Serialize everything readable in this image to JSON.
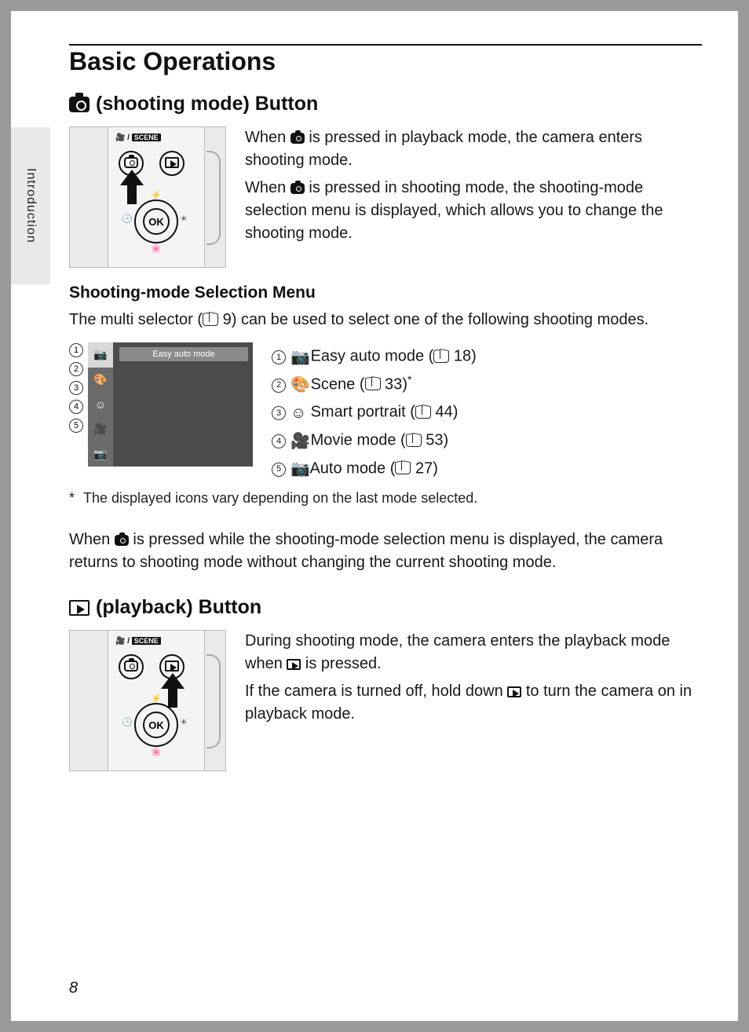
{
  "side_tab": "Introduction",
  "page_title": "Basic Operations",
  "page_number": "8",
  "section1": {
    "heading": "(shooting mode) Button",
    "para1_a": "When ",
    "para1_b": " is pressed in playback mode, the camera enters shooting mode.",
    "para2_a": "When ",
    "para2_b": " is pressed in shooting mode, the shooting-mode selection menu is displayed, which allows you to change the shooting mode."
  },
  "subsection": {
    "heading": "Shooting-mode Selection Menu",
    "intro_a": "The multi selector (",
    "intro_ref": " 9",
    "intro_b": ") can be used to select one of the following shooting modes.",
    "menu_label": "Easy auto mode",
    "modes": [
      {
        "num": "1",
        "glyph": "📷",
        "label": "Easy auto mode",
        "ref": " 18",
        "suffix": ""
      },
      {
        "num": "2",
        "glyph": "🎨",
        "label": "Scene",
        "ref": " 33",
        "suffix": "*"
      },
      {
        "num": "3",
        "glyph": "☺",
        "label": "Smart portrait",
        "ref": " 44",
        "suffix": ""
      },
      {
        "num": "4",
        "glyph": "🎥",
        "label": "Movie mode",
        "ref": " 53",
        "suffix": ""
      },
      {
        "num": "5",
        "glyph": "📷",
        "label": "Auto mode",
        "ref": " 27",
        "suffix": ""
      }
    ],
    "footnote": "The displayed icons vary depending on the last mode selected.",
    "closing_a": "When ",
    "closing_b": " is pressed while the shooting-mode selection menu is displayed, the camera returns to shooting mode without changing the current shooting mode."
  },
  "section2": {
    "heading": "(playback) Button",
    "para1_a": "During shooting mode, the camera enters the playback mode when ",
    "para1_b": " is pressed.",
    "para2_a": "If the camera is turned off, hold down ",
    "para2_b": " to turn the camera on in playback mode."
  },
  "diagram_ok": "OK",
  "diagram_scene": "SCENE"
}
